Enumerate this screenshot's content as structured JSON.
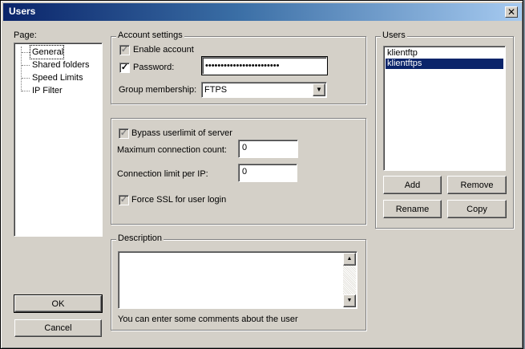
{
  "window": {
    "title": "Users",
    "close_glyph": "✕"
  },
  "page_panel": {
    "label": "Page:",
    "items": [
      {
        "label": "General",
        "selected": true
      },
      {
        "label": "Shared folders"
      },
      {
        "label": "Speed Limits"
      },
      {
        "label": "IP Filter"
      }
    ]
  },
  "account": {
    "legend": "Account settings",
    "enable_label": "Enable account",
    "password_label": "Password:",
    "password_value": "••••••••••••••••••••••••",
    "group_label": "Group membership:",
    "group_value": "FTPS"
  },
  "limits": {
    "bypass_label": "Bypass userlimit of server",
    "max_conn_label": "Maximum connection count:",
    "max_conn_value": "0",
    "per_ip_label": "Connection limit per IP:",
    "per_ip_value": "0",
    "force_ssl_label": "Force SSL for user login"
  },
  "description": {
    "legend": "Description",
    "value": "",
    "hint": "You can enter some comments about the user"
  },
  "users": {
    "legend": "Users",
    "items": [
      {
        "name": "klientftp"
      },
      {
        "name": "klientftps",
        "selected": true
      }
    ],
    "add_label": "Add",
    "remove_label": "Remove",
    "rename_label": "Rename",
    "copy_label": "Copy"
  },
  "buttons": {
    "ok_label": "OK",
    "cancel_label": "Cancel"
  },
  "glyphs": {
    "check": "✓",
    "arrow_down": "▼",
    "arrow_up": "▲"
  },
  "colors": {
    "title_bar": "#0a246a",
    "selection": "#0a246a",
    "face": "#d4d0c8"
  }
}
